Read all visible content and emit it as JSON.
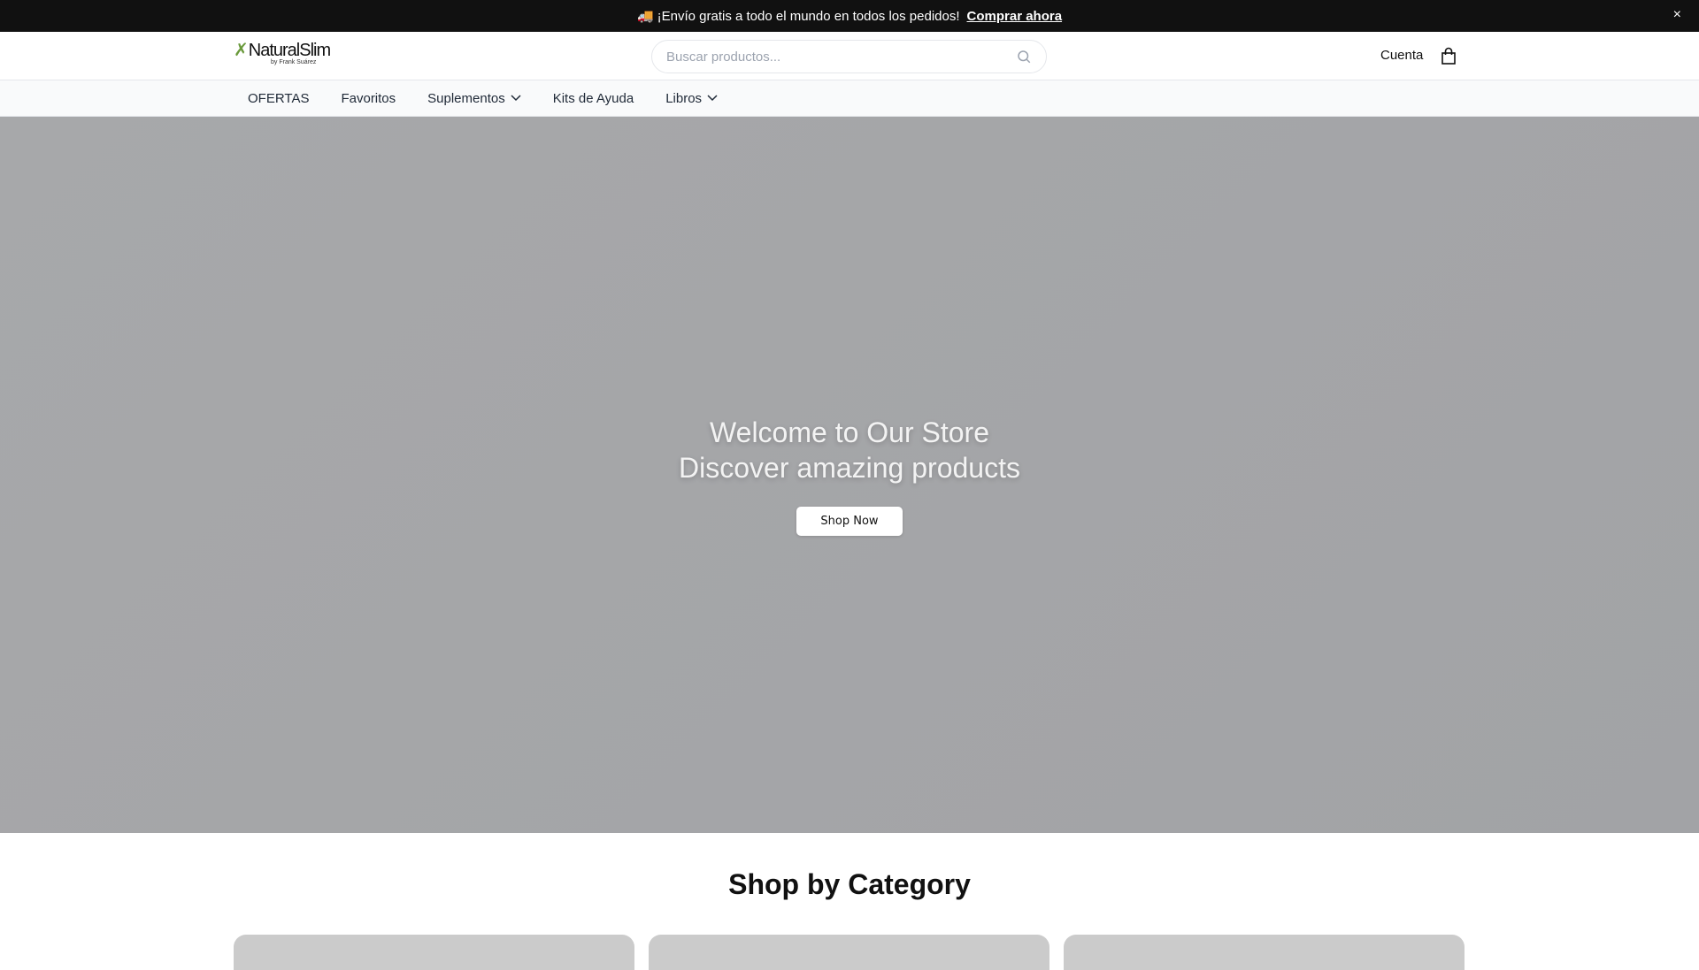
{
  "announcement": {
    "icon": "🚚",
    "text": "¡Envío gratis a todo el mundo en todos los pedidos!",
    "link": "Comprar ahora",
    "close": "×"
  },
  "header": {
    "logo": "NaturalSlim",
    "logo_sub": "by Frank Suárez",
    "search_placeholder": "Buscar productos...",
    "account": "Cuenta"
  },
  "nav": {
    "items": [
      {
        "label": "OFERTAS"
      },
      {
        "label": "Favoritos"
      },
      {
        "label": "Suplementos",
        "dropdown": true
      },
      {
        "label": "Kits de Ayuda"
      },
      {
        "label": "Libros",
        "dropdown": true
      }
    ]
  },
  "hero": {
    "line1": "Welcome to Our Store",
    "line2": "Discover amazing products",
    "cta": "Shop Now"
  },
  "categories": {
    "title": "Shop by Category"
  }
}
